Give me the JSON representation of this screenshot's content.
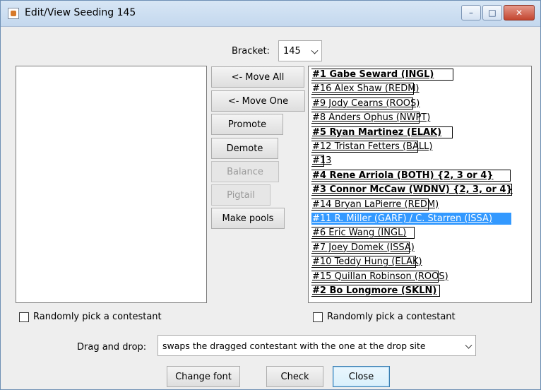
{
  "window": {
    "title": "Edit/View Seeding 145",
    "controls": {
      "minimize": "–",
      "maximize": "□",
      "close": "✕"
    }
  },
  "bracket": {
    "label": "Bracket:",
    "value": "145"
  },
  "buttons": {
    "move_all": "<- Move All",
    "move_one": "<- Move One",
    "promote": "Promote",
    "demote": "Demote",
    "balance": "Balance",
    "pigtail": "Pigtail",
    "make_pools": "Make pools"
  },
  "seeding": [
    {
      "text": "#1 Gabe Seward (INGL)",
      "bold": true
    },
    {
      "text": "#16 Alex Shaw (REDM)",
      "bold": false
    },
    {
      "text": "#9 Jody Cearns (ROOS)",
      "bold": false
    },
    {
      "text": "#8 Anders Ophus (NWPT)",
      "bold": false
    },
    {
      "text": "#5 Ryan Martinez (ELAK)",
      "bold": true
    },
    {
      "text": "#12 Tristan Fetters (BALL)",
      "bold": false
    },
    {
      "text": "#13",
      "bold": false
    },
    {
      "text": "#4 Rene Arriola (BOTH) {2, 3 or 4}",
      "bold": true
    },
    {
      "text": "#3 Connor McCaw (WDNV) {2, 3, or 4}",
      "bold": true
    },
    {
      "text": "#14 Bryan LaPierre (REDM)",
      "bold": false
    },
    {
      "text": "#11 R. Miller (GARF) / C. Starren (ISSA)",
      "bold": false,
      "selected": true
    },
    {
      "text": "#6 Eric Wang (INGL)",
      "bold": false
    },
    {
      "text": "#7 Joey Domek (ISSA)",
      "bold": false
    },
    {
      "text": "#10 Teddy Hung (ELAK)",
      "bold": false
    },
    {
      "text": "#15 Quillan Robinson (ROOS)",
      "bold": false
    },
    {
      "text": "#2 Bo Longmore (SKLN)",
      "bold": true
    }
  ],
  "left_random_label": "Randomly pick a contestant",
  "right_random_label": "Randomly pick a contestant",
  "drag_drop": {
    "label": "Drag and drop:",
    "value": "swaps the dragged contestant with the one at the drop site"
  },
  "footer": {
    "change_font": "Change font",
    "check": "Check",
    "close": "Close"
  }
}
